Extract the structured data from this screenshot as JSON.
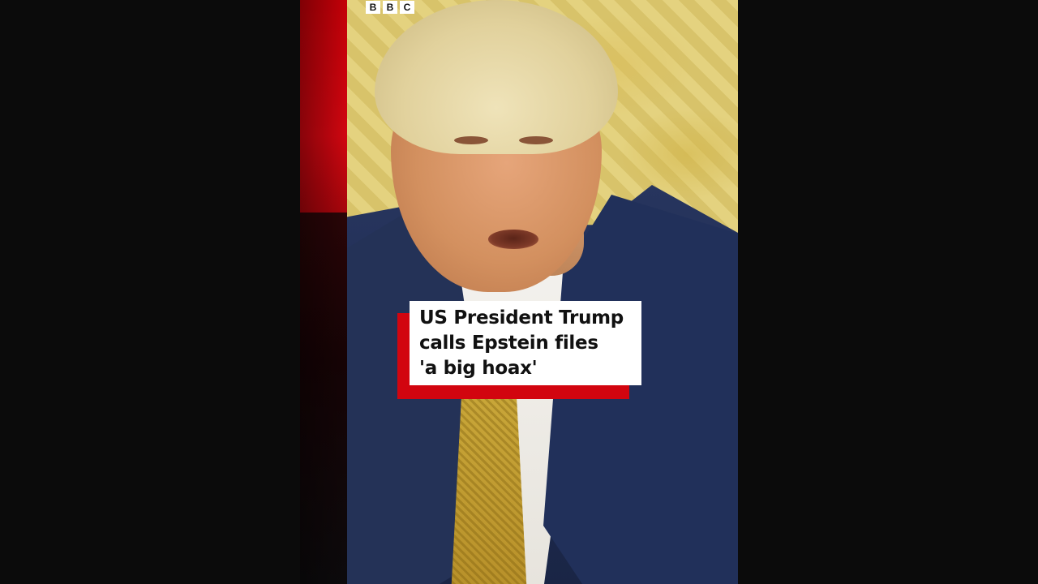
{
  "brand": {
    "letters": [
      "B",
      "B",
      "C"
    ],
    "accent_color": "#d2050f"
  },
  "caption": {
    "lines": [
      "US President Trump",
      "calls Epstein files",
      "'a big hoax'"
    ]
  }
}
